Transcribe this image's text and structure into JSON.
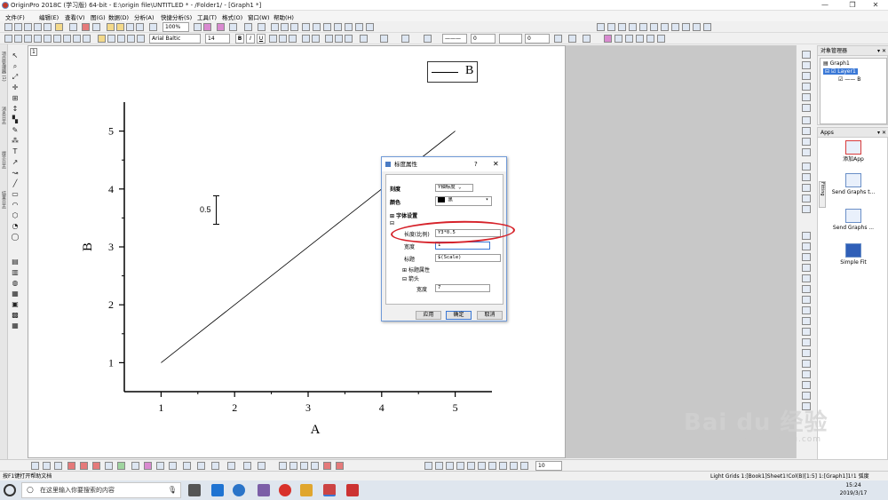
{
  "window": {
    "title": "OriginPro 2018C (学习版) 64-bit - E:\\origin file\\UNTITLED * - /Folder1/ - [Graph1 *]"
  },
  "menu": [
    "文件(F)",
    "编辑(E)",
    "查看(V)",
    "图(G)",
    "数据(D)",
    "分析(A)",
    "快捷分析(S)",
    "工具(T)",
    "格式(O)",
    "窗口(W)",
    "帮助(H)"
  ],
  "toolbar": {
    "zoom": "100%",
    "font_name": "Arial Baltic",
    "font_size": "14",
    "bold": "B",
    "italic": "I",
    "underline": "U",
    "line_width_1": "0",
    "line_width_2": "0"
  },
  "left_tabs": [
    "项目管理器 (1)",
    "消息日志",
    "提示日志",
    "结果日志"
  ],
  "graph": {
    "page_number": "1",
    "legend_label": "B",
    "error_label": "0.5"
  },
  "chart_data": {
    "type": "line",
    "x": [
      1,
      5
    ],
    "series": [
      {
        "name": "B",
        "values": [
          1,
          5
        ]
      }
    ],
    "xlabel": "A",
    "ylabel": "B",
    "xlim": [
      0.5,
      5.5
    ],
    "ylim": [
      0.5,
      5.5
    ],
    "xticks": [
      1,
      2,
      3,
      4,
      5
    ],
    "yticks": [
      1,
      2,
      3,
      4,
      5
    ],
    "grid": false,
    "legend": "top-right"
  },
  "dialog": {
    "title": "标度属性",
    "help": "?",
    "close": "✕",
    "scale_label": "刻度",
    "scale_value": "Y轴标度",
    "color_label": "颜色",
    "color_value": "黑",
    "font_settings": "字体设置",
    "length_label": "长度(比例)",
    "length_value": "Y3*0.5",
    "width_label": "宽度",
    "width_value": "1",
    "caption_label": "标题",
    "caption_value": "$(Scale)",
    "caption_props": "标题属性",
    "arrow_label": "箭头",
    "arrow_width_label": "宽度",
    "arrow_width_value": "7",
    "apply": "应用",
    "ok": "确定",
    "cancel": "取消"
  },
  "object_manager": {
    "title": "对象管理器",
    "graph": "Graph1",
    "layer": "Layer1",
    "plot": "B"
  },
  "apps": {
    "title": "Apps",
    "items": [
      "添加App",
      "Send Graphs t...",
      "Send Graphs ...",
      "Simple Fit"
    ],
    "fitting_tab": "Fitting"
  },
  "bottom_toolbar": {
    "font_size": "10"
  },
  "statusbar": {
    "help": "按F1键打开帮助文档",
    "info": "Light Grids  1:[Book1]Sheet1!Col(B)[1:5]  1:[Graph1]1!1  弧度"
  },
  "taskbar": {
    "search_placeholder": "在这里输入你要搜索的内容",
    "time": "15:24",
    "date": "2019/3/17"
  },
  "watermark": {
    "text": "Bai du 经验",
    "url": "jingyan.baidu.com"
  },
  "colors": {
    "accent": "#3a78d6",
    "highlight_circle": "#d6222a",
    "plot_line": "#000000"
  }
}
